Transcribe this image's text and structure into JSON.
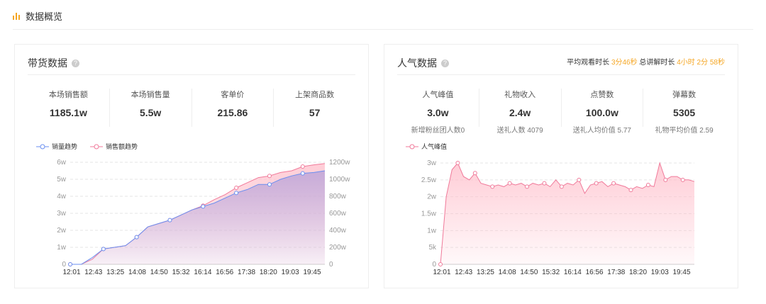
{
  "header": {
    "title": "数据概览"
  },
  "sales": {
    "title": "带货数据",
    "stats": [
      {
        "label": "本场销售额",
        "value": "1185.1w"
      },
      {
        "label": "本场销售量",
        "value": "5.5w"
      },
      {
        "label": "客单价",
        "value": "215.86"
      },
      {
        "label": "上架商品数",
        "value": "57"
      }
    ]
  },
  "popularity": {
    "title": "人气数据",
    "avg_watch_label": "平均观看时长",
    "avg_watch": "3分46秒",
    "total_label": "总讲解时长",
    "total": "4小时 2分 58秒",
    "stats": [
      {
        "label": "人气峰值",
        "value": "3.0w",
        "sub": "新增粉丝团人数0"
      },
      {
        "label": "礼物收入",
        "value": "2.4w",
        "sub": "送礼人数 4079"
      },
      {
        "label": "点赞数",
        "value": "100.0w",
        "sub": "送礼人均价值 5.77"
      },
      {
        "label": "弹幕数",
        "value": "5305",
        "sub": "礼物平均价值 2.59"
      }
    ]
  },
  "chart_data": [
    {
      "type": "line",
      "legend": [
        "销量趋势",
        "销售额趋势"
      ],
      "categories": [
        "12:01",
        "12:43",
        "13:25",
        "14:08",
        "14:50",
        "15:32",
        "16:14",
        "16:56",
        "17:38",
        "18:20",
        "19:03",
        "19:45"
      ],
      "y_left_ticks": [
        "0",
        "1w",
        "2w",
        "3w",
        "4w",
        "5w",
        "6w"
      ],
      "y_right_ticks": [
        "0",
        "200w",
        "400w",
        "600w",
        "800w",
        "1000w",
        "1200w"
      ],
      "ylim_left": [
        0,
        6
      ],
      "ylim_right": [
        0,
        1200
      ],
      "series": [
        {
          "name": "销量趋势",
          "unit": "w",
          "color": "#6a8ff0",
          "values": [
            0,
            0,
            0.4,
            0.9,
            1.0,
            1.1,
            1.6,
            2.2,
            2.4,
            2.6,
            2.9,
            3.2,
            3.4,
            3.6,
            3.9,
            4.2,
            4.4,
            4.7,
            4.7,
            5.0,
            5.2,
            5.35,
            5.4,
            5.5
          ]
        },
        {
          "name": "销售额趋势",
          "unit": "w",
          "color": "#f07a9a",
          "values": [
            0,
            0,
            60,
            180,
            200,
            220,
            320,
            440,
            480,
            520,
            580,
            640,
            690,
            760,
            820,
            900,
            960,
            1020,
            1040,
            1080,
            1100,
            1150,
            1170,
            1185
          ]
        }
      ]
    },
    {
      "type": "area",
      "legend": [
        "人气峰值"
      ],
      "categories": [
        "12:01",
        "12:43",
        "13:25",
        "14:08",
        "14:50",
        "15:32",
        "16:14",
        "16:56",
        "17:38",
        "18:20",
        "19:03",
        "19:45"
      ],
      "y_ticks": [
        "0",
        "5k",
        "1w",
        "1.5w",
        "2w",
        "2.5w",
        "3w"
      ],
      "ylim": [
        0,
        3
      ],
      "series": [
        {
          "name": "人气峰值",
          "unit": "w",
          "color": "#f07a9a",
          "values": [
            0,
            2.0,
            2.8,
            3.0,
            2.6,
            2.5,
            2.7,
            2.4,
            2.35,
            2.3,
            2.35,
            2.3,
            2.4,
            2.35,
            2.4,
            2.3,
            2.4,
            2.35,
            2.4,
            2.3,
            2.5,
            2.3,
            2.4,
            2.35,
            2.5,
            2.1,
            2.35,
            2.4,
            2.45,
            2.3,
            2.4,
            2.35,
            2.3,
            2.2,
            2.3,
            2.25,
            2.35,
            2.3,
            3.0,
            2.5,
            2.6,
            2.6,
            2.5,
            2.5,
            2.45
          ]
        }
      ]
    }
  ]
}
